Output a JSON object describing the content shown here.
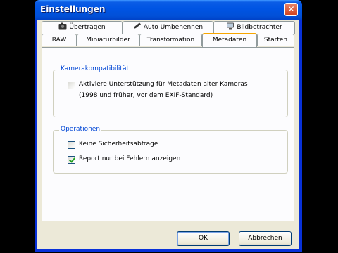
{
  "window": {
    "title": "Einstellungen",
    "close_glyph": "✕"
  },
  "tabs_row_top": [
    {
      "label": "Übertragen",
      "icon": "camera-icon"
    },
    {
      "label": "Auto Umbenennen",
      "icon": "pen-icon"
    },
    {
      "label": "Bildbetrachter",
      "icon": "monitor-icon"
    }
  ],
  "tabs_row_bottom": [
    "RAW",
    "Miniaturbilder",
    "Transformation",
    "Metadaten",
    "Starten"
  ],
  "active_tab": "Metadaten",
  "group_camera": {
    "title": "Kamerakompatibilität",
    "checkbox_label_line1": "Aktiviere Unterstützung für Metadaten alter Kameras",
    "checkbox_label_line2": "(1998 und früher, vor dem EXIF-Standard)",
    "checked": false
  },
  "group_operations": {
    "title": "Operationen",
    "items": [
      {
        "label": "Keine Sicherheitsabfrage",
        "checked": false
      },
      {
        "label": "Report nur bei Fehlern anzeigen",
        "checked": true
      }
    ]
  },
  "buttons": {
    "ok": "OK",
    "cancel": "Abbrechen"
  },
  "colors": {
    "title_bar": "#0054e3",
    "dialog_bg": "#ece9d8",
    "group_title": "#0046d5",
    "active_tab_accent": "#f7a600"
  }
}
